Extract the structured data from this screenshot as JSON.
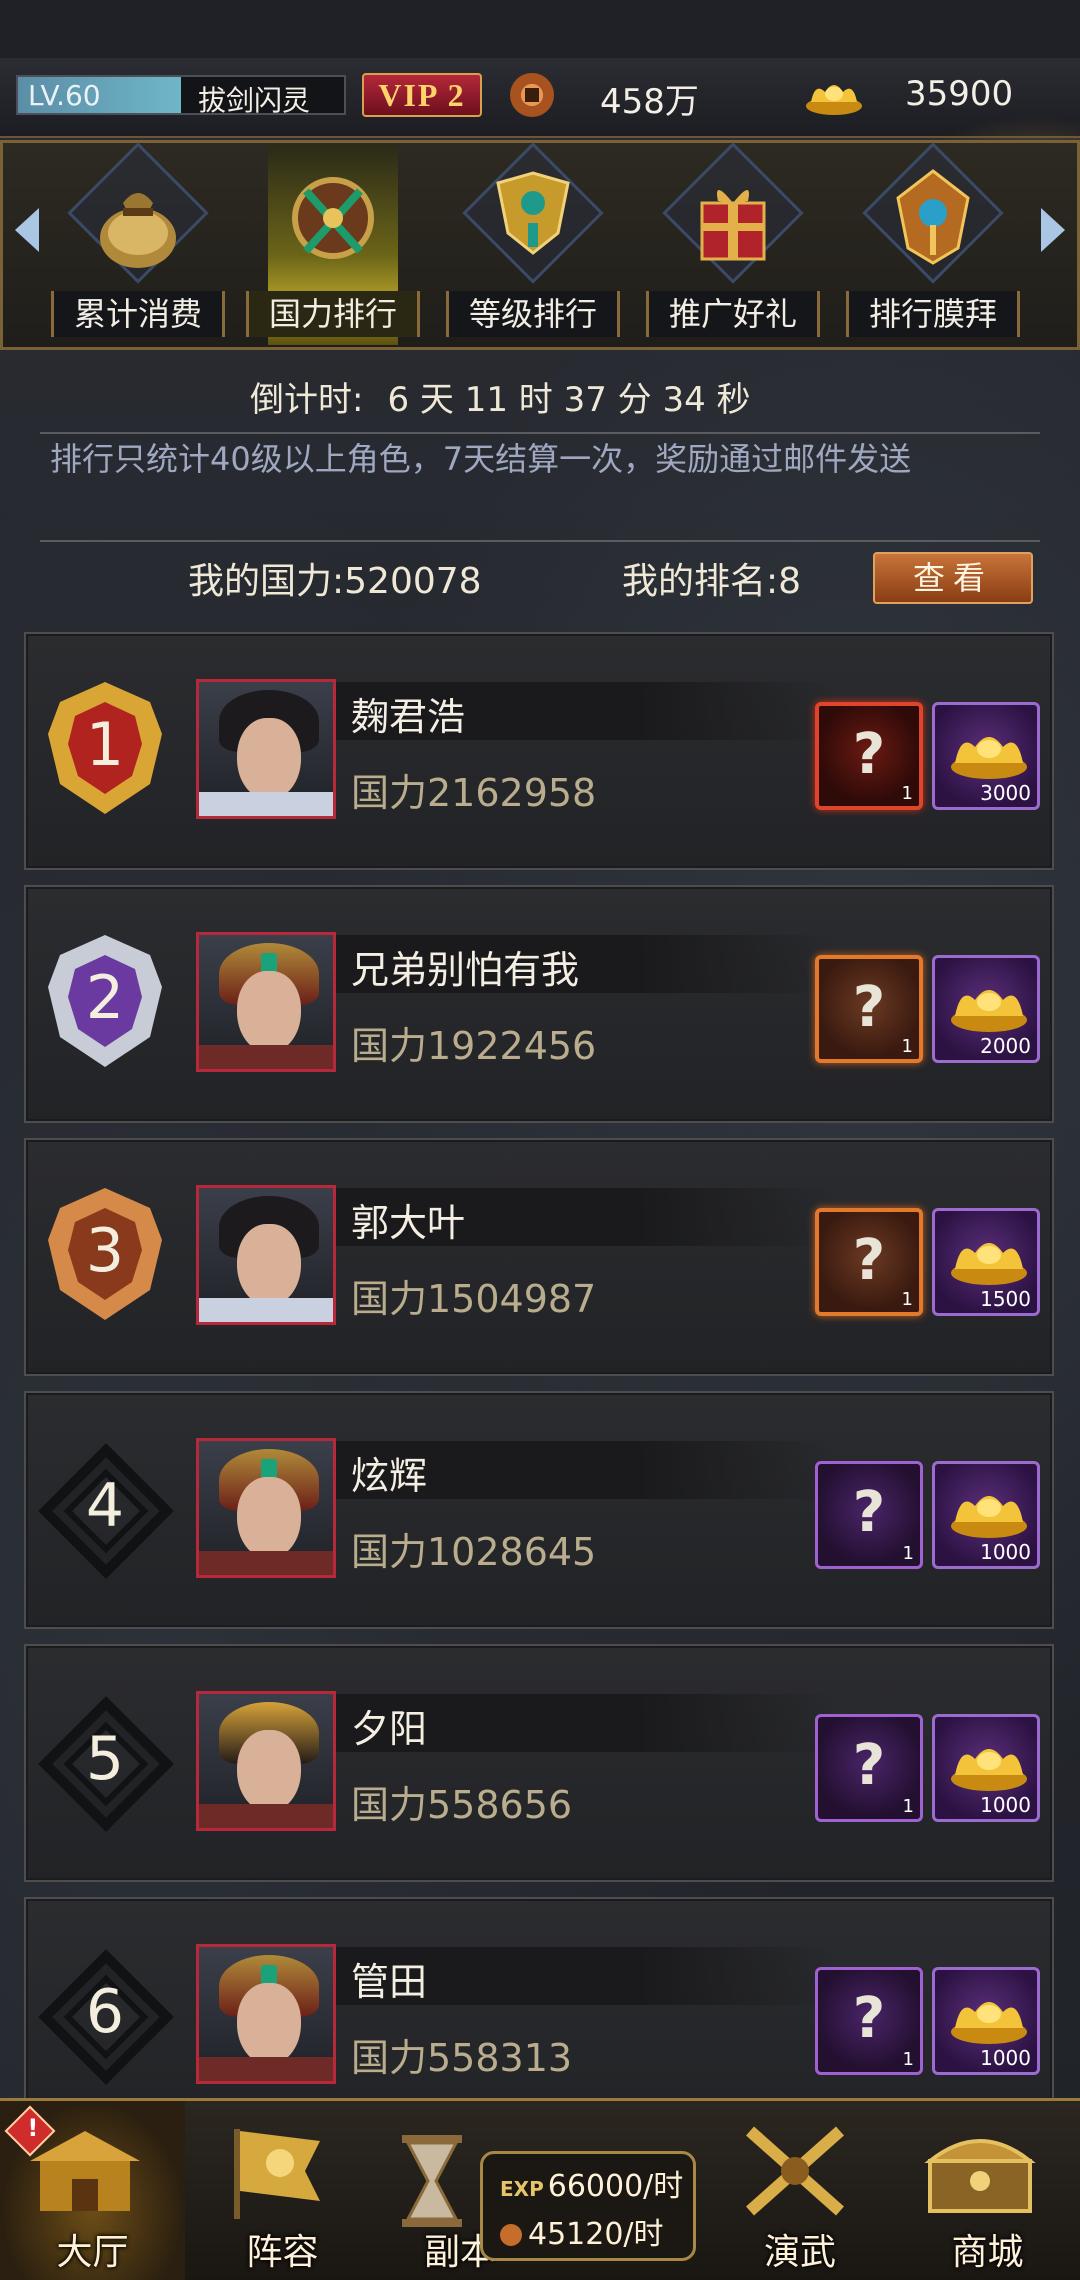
{
  "header": {
    "level": "LV.60",
    "player_name": "拔剑闪灵",
    "vip": "VIP 2",
    "coin_value": "458万",
    "gold_value": "35900",
    "icons": [
      "copper-coin-icon",
      "gold-ingot-icon"
    ]
  },
  "tabs": [
    {
      "label": "累计消费",
      "icon": "money-bag-icon",
      "active": false
    },
    {
      "label": "国力排行",
      "icon": "crossed-swords-emblem-icon",
      "active": true
    },
    {
      "label": "等级排行",
      "icon": "golden-trophy-icon",
      "active": false
    },
    {
      "label": "推广好礼",
      "icon": "gift-box-icon",
      "active": false
    },
    {
      "label": "排行膜拜",
      "icon": "ornate-emblem-icon",
      "active": false
    }
  ],
  "countdown": {
    "label": "倒计时:",
    "value": "6 天 11 时 37 分 34 秒"
  },
  "notice": "排行只统计40级以上角色，7天结算一次，奖励通过邮件发送",
  "summary": {
    "my_power": "我的国力:520078",
    "my_rank": "我的排名:8",
    "view_button": "查看"
  },
  "rankings": [
    {
      "rank": "1",
      "name": "麹君浩",
      "power": "国力2162958",
      "mystery_count": "1",
      "gold_count": "3000"
    },
    {
      "rank": "2",
      "name": "兄弟别怕有我",
      "power": "国力1922456",
      "mystery_count": "1",
      "gold_count": "2000"
    },
    {
      "rank": "3",
      "name": "郭大叶",
      "power": "国力1504987",
      "mystery_count": "1",
      "gold_count": "1500"
    },
    {
      "rank": "4",
      "name": "炫辉",
      "power": "国力1028645",
      "mystery_count": "1",
      "gold_count": "1000"
    },
    {
      "rank": "5",
      "name": "夕阳",
      "power": "国力558656",
      "mystery_count": "1",
      "gold_count": "1000"
    },
    {
      "rank": "6",
      "name": "管田",
      "power": "国力558313",
      "mystery_count": "1",
      "gold_count": "1000"
    }
  ],
  "bottom_nav": {
    "items": [
      {
        "label": "大厅",
        "icon": "palace-icon",
        "active": true,
        "alert": "!"
      },
      {
        "label": "阵容",
        "icon": "banner-flag-icon",
        "active": false
      },
      {
        "label": "副本",
        "icon": "hourglass-icon",
        "active": false
      },
      {
        "label": "演武",
        "icon": "crossed-swords-icon",
        "active": false
      },
      {
        "label": "商城",
        "icon": "treasure-chest-icon",
        "active": false
      }
    ],
    "exp_rate": "66000/时",
    "exp_label": "EXP",
    "coin_rate": "45120/时"
  },
  "colors": {
    "accent_gold": "#d7a04a",
    "vip_red": "#b4283a",
    "button_orange": "#c8743a",
    "reward_purple": "#5b2f7a"
  }
}
